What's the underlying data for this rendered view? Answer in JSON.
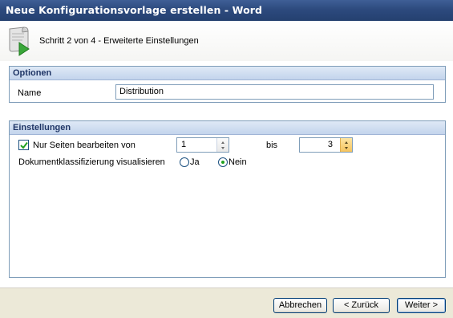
{
  "window": {
    "title": "Neue Konfigurationsvorlage erstellen - Word"
  },
  "header": {
    "icon": "document-wizard-icon",
    "step_text": "Schritt 2 von 4 - Erweiterte Einstellungen"
  },
  "optionen": {
    "title": "Optionen",
    "name_label": "Name",
    "name_value": "Distribution"
  },
  "einstellungen": {
    "title": "Einstellungen",
    "pages_checkbox_label": "Nur Seiten bearbeiten von",
    "pages_checked": true,
    "from_value": "1",
    "to_label": "bis",
    "to_value": "3",
    "visualize_label": "Dokumentklassifizierung visualisieren",
    "option_ja": "Ja",
    "option_nein": "Nein",
    "selected_option": "Nein"
  },
  "footer": {
    "cancel_label": "Abbrechen",
    "back_label": "< Zurück",
    "next_label": "Weiter >"
  },
  "colors": {
    "titlebar": "#2d4a7e",
    "group_header_text": "#1f3566",
    "radio_selected": "#21a121"
  }
}
